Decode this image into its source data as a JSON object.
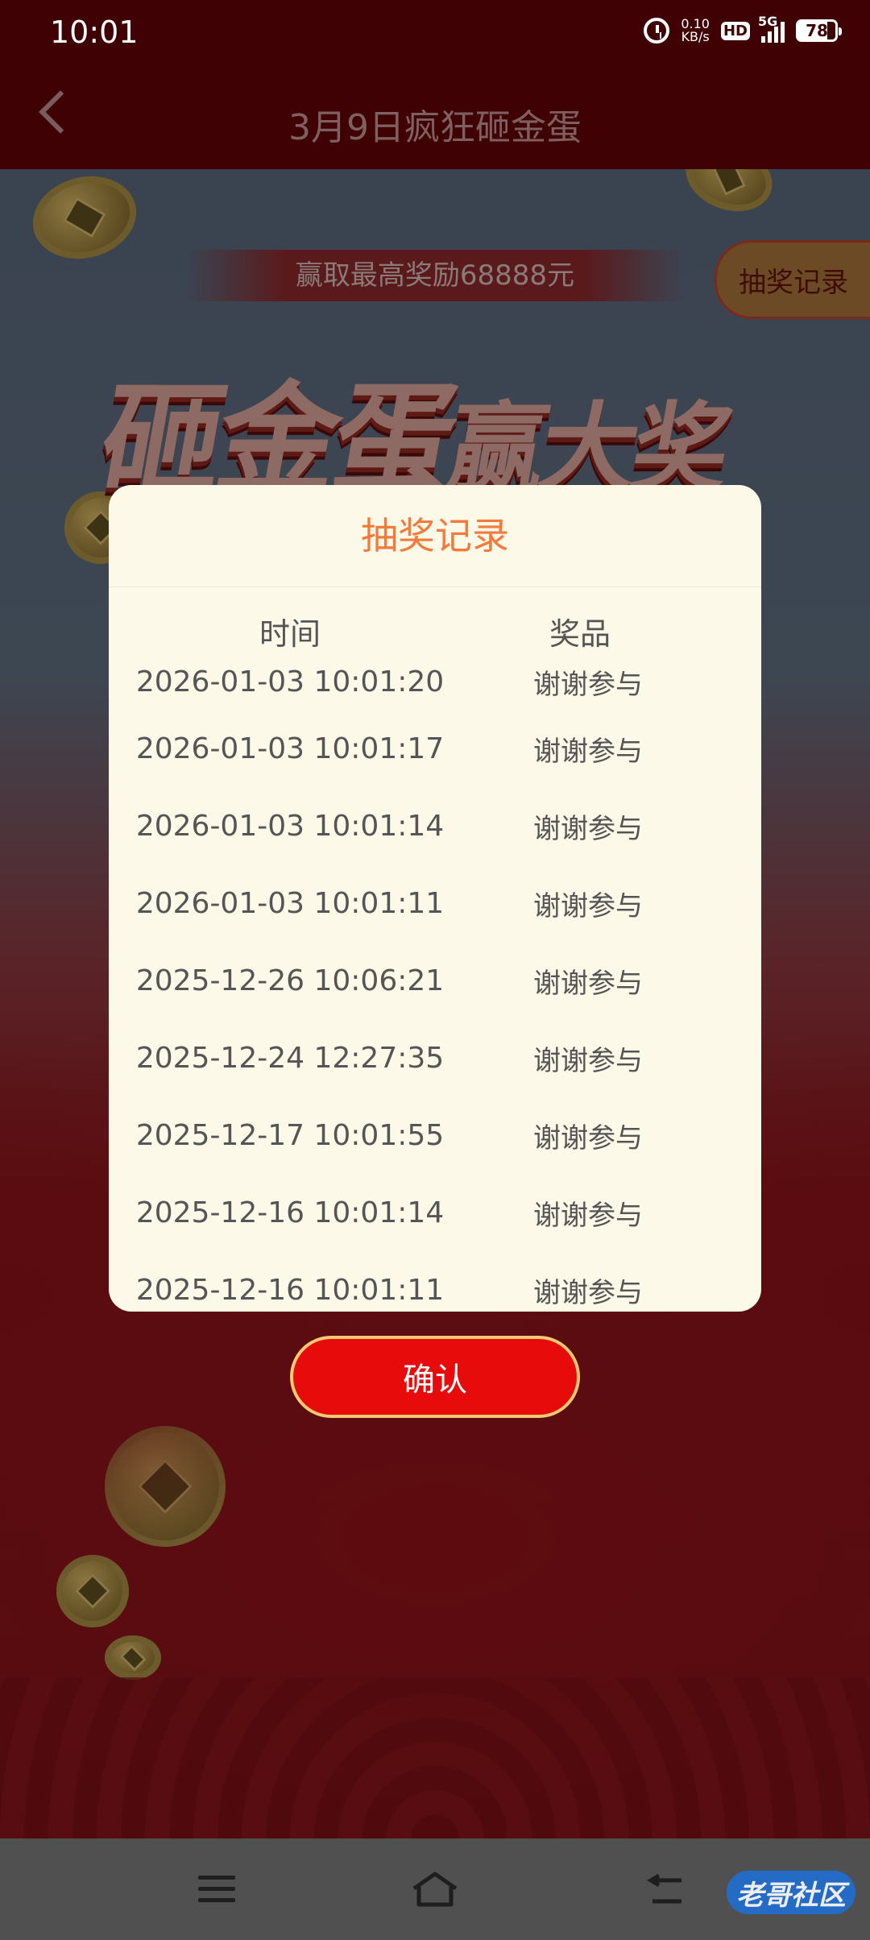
{
  "status_bar": {
    "time": "10:01",
    "net_speed_value": "0.10",
    "net_speed_unit": "KB/s",
    "hd": "HD",
    "network": "5G",
    "battery": "78"
  },
  "header": {
    "title": "3月9日疯狂砸金蛋"
  },
  "promo": {
    "banner": "赢取最高奖励68888元",
    "record_button": "抽奖记录",
    "headline_main": "砸金蛋",
    "headline_sub": "赢大奖"
  },
  "modal": {
    "title": "抽奖记录",
    "columns": {
      "time": "时间",
      "prize": "奖品"
    },
    "rows": [
      {
        "time": "2026-01-03 10:01:20",
        "prize": "谢谢参与"
      },
      {
        "time": "2026-01-03 10:01:17",
        "prize": "谢谢参与"
      },
      {
        "time": "2026-01-03 10:01:14",
        "prize": "谢谢参与"
      },
      {
        "time": "2026-01-03 10:01:11",
        "prize": "谢谢参与"
      },
      {
        "time": "2025-12-26 10:06:21",
        "prize": "谢谢参与"
      },
      {
        "time": "2025-12-24 12:27:35",
        "prize": "谢谢参与"
      },
      {
        "time": "2025-12-17 10:01:55",
        "prize": "谢谢参与"
      },
      {
        "time": "2025-12-16 10:01:14",
        "prize": "谢谢参与"
      },
      {
        "time": "2025-12-16 10:01:11",
        "prize": "谢谢参与"
      }
    ],
    "confirm": "确认"
  },
  "watermark": "老哥社区",
  "colors": {
    "modal_title": "#f47a3c",
    "confirm_bg": "#e80b0b",
    "confirm_border": "#f3c873",
    "modal_bg": "#fdf9e8"
  }
}
